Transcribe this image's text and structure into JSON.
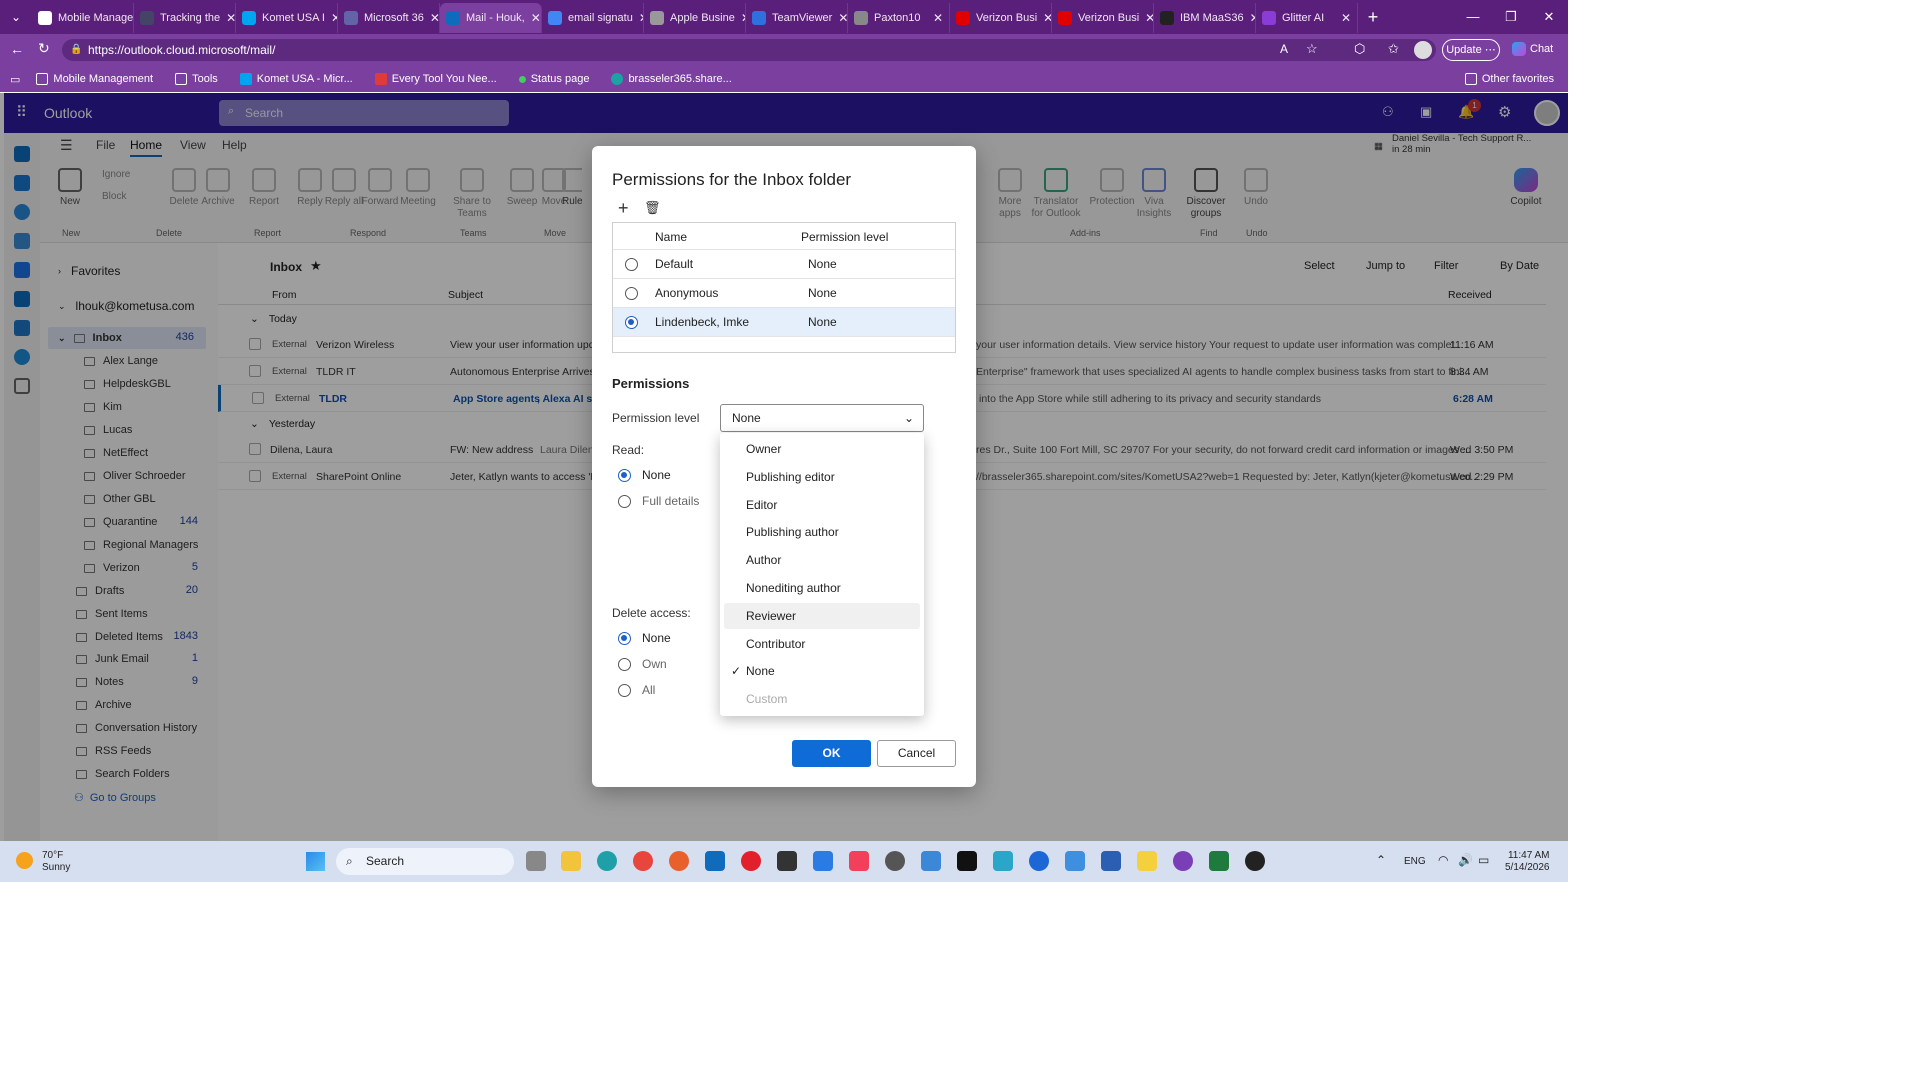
{
  "browser": {
    "tabs": [
      {
        "title": "Mobile Management",
        "color": "#ffffff"
      },
      {
        "title": "Tracking the",
        "color": "#444466"
      },
      {
        "title": "Komet USA I",
        "color": "#00a4ef"
      },
      {
        "title": "Microsoft 36",
        "color": "#6264a7"
      },
      {
        "title": "Mail - Houk,",
        "color": "#0f6cbd",
        "active": true
      },
      {
        "title": "email signatu",
        "color": "#4285f4"
      },
      {
        "title": "Apple Busine",
        "color": "#999999"
      },
      {
        "title": "TeamViewer",
        "color": "#2f6fde"
      },
      {
        "title": "Paxton10",
        "color": "#888888"
      },
      {
        "title": "Verizon Busi",
        "color": "#e00000"
      },
      {
        "title": "Verizon Busi",
        "color": "#e00000"
      },
      {
        "title": "IBM MaaS36",
        "color": "#222222"
      },
      {
        "title": "Glitter AI",
        "color": "#8a3dd6"
      }
    ],
    "url": "https://outlook.cloud.microsoft/mail/",
    "update_label": "Update",
    "chat_label": "Chat",
    "favorites": [
      "Mobile Management",
      "Tools",
      "Komet USA - Micr...",
      "Every Tool You Nee...",
      "Status page",
      "brasseler365.share..."
    ],
    "other_favorites": "Other favorites"
  },
  "outlook": {
    "app_name": "Outlook",
    "search_placeholder": "Search",
    "reminder": {
      "title": "Daniel Sevilla - Tech Support R...",
      "time": "in 28 min"
    },
    "notification_count": "1",
    "menu": [
      "File",
      "Home",
      "View",
      "Help"
    ],
    "active_menu": "Home",
    "ribbon": {
      "new": "New",
      "ignore": "Ignore",
      "block": "Block",
      "delete": "Delete",
      "archive": "Archive",
      "report": "Report",
      "reply": "Reply",
      "reply_all": "Reply all",
      "forward": "Forward",
      "meeting": "Meeting",
      "share_to_teams": "Share to Teams",
      "sweep": "Sweep",
      "move": "Move",
      "rules": "Rule",
      "more_apps": "More apps",
      "translator": "Translator for Outlook",
      "protection": "Protection",
      "viva": "Viva Insights",
      "discover": "Discover groups",
      "undo": "Undo",
      "copilot": "Copilot",
      "groups": {
        "new": "New",
        "delete": "Delete",
        "report": "Report",
        "respond": "Respond",
        "teams": "Teams",
        "move": "Move",
        "addins": "Add-ins",
        "find": "Find",
        "undo": "Undo"
      }
    },
    "favorites_label": "Favorites",
    "account": "lhouk@kometusa.com",
    "folders": [
      {
        "name": "Inbox",
        "count": "436"
      },
      {
        "name": "Alex Lange",
        "count": ""
      },
      {
        "name": "HelpdeskGBL",
        "count": ""
      },
      {
        "name": "Kim",
        "count": ""
      },
      {
        "name": "Lucas",
        "count": ""
      },
      {
        "name": "NetEffect",
        "count": ""
      },
      {
        "name": "Oliver Schroeder",
        "count": ""
      },
      {
        "name": "Other GBL",
        "count": ""
      },
      {
        "name": "Quarantine",
        "count": "144"
      },
      {
        "name": "Regional Managers",
        "count": ""
      },
      {
        "name": "Verizon",
        "count": "5"
      },
      {
        "name": "Drafts",
        "count": "20"
      },
      {
        "name": "Sent Items",
        "count": ""
      },
      {
        "name": "Deleted Items",
        "count": "1843"
      },
      {
        "name": "Junk Email",
        "count": "1"
      },
      {
        "name": "Notes",
        "count": "9"
      },
      {
        "name": "Archive",
        "count": ""
      },
      {
        "name": "Conversation History",
        "count": ""
      },
      {
        "name": "RSS Feeds",
        "count": ""
      },
      {
        "name": "Search Folders",
        "count": ""
      }
    ],
    "go_to_groups": "Go to Groups",
    "list": {
      "title": "Inbox",
      "select": "Select",
      "jump_to": "Jump to",
      "filter": "Filter",
      "by_date": "By Date",
      "col_from": "From",
      "col_subject": "Subject",
      "col_received": "Received",
      "group_today": "Today",
      "group_yesterday": "Yesterday",
      "rows": [
        {
          "tag": "External",
          "from": "Verizon Wireless",
          "subject": "View your user information upda",
          "preview": "your user information details. View service history Your request to update user information was complet...",
          "time": "11:16 AM"
        },
        {
          "tag": "External",
          "from": "TLDR IT",
          "subject": "Autonomous Enterprise Arrives",
          "preview": "Enterprise\" framework that uses specialized AI agents to handle complex business tasks from start to fini...",
          "time": "8:34 AM"
        },
        {
          "tag": "External",
          "from": "TLDR",
          "subject": "App Store agents",
          "subject2": ", Alexa AI s",
          "preview": "into the App Store while still adhering to its privacy and security standards",
          "time": "6:28 AM",
          "unread": true
        },
        {
          "tag": "",
          "from": "Dilena, Laura",
          "subject": "FW: New address",
          "subject2": "Laura Dilena S",
          "preview": "res Dr., Suite 100 Fort Mill, SC 29707 For your security, do not forward credit card information or images ...",
          "time": "Wed 3:50 PM"
        },
        {
          "tag": "External",
          "from": "SharePoint Online",
          "subject": "Jeter, Katlyn wants to access 'Ko",
          "preview": "//brasseler365.sharepoint.com/sites/KometUSA2?web=1 Requested by: Jeter, Katlyn(kjeter@kometusa.co...",
          "time": "Wed 2:29 PM"
        }
      ]
    }
  },
  "dialog": {
    "title": "Permissions for the Inbox folder",
    "col_name": "Name",
    "col_level": "Permission level",
    "entries": [
      {
        "name": "Default",
        "level": "None",
        "selected": false
      },
      {
        "name": "Anonymous",
        "level": "None",
        "selected": false
      },
      {
        "name": "Lindenbeck, Imke",
        "level": "None",
        "selected": true
      }
    ],
    "permissions_heading": "Permissions",
    "permission_level_label": "Permission level",
    "permission_level_value": "None",
    "read_label": "Read:",
    "read_options": [
      "None",
      "Full details"
    ],
    "read_selected": "None",
    "delete_label": "Delete access:",
    "delete_options": [
      "None",
      "Own",
      "All"
    ],
    "delete_selected": "None",
    "dropdown_options": [
      "Owner",
      "Publishing editor",
      "Editor",
      "Publishing author",
      "Author",
      "Nonediting author",
      "Reviewer",
      "Contributor",
      "None",
      "Custom"
    ],
    "dropdown_checked": "None",
    "dropdown_hover": "Reviewer",
    "dropdown_disabled": "Custom",
    "ok": "OK",
    "cancel": "Cancel"
  },
  "taskbar": {
    "weather_temp": "70°F",
    "weather_desc": "Sunny",
    "search": "Search",
    "lang": "ENG",
    "time": "11:47 AM",
    "date": "5/14/2026"
  }
}
